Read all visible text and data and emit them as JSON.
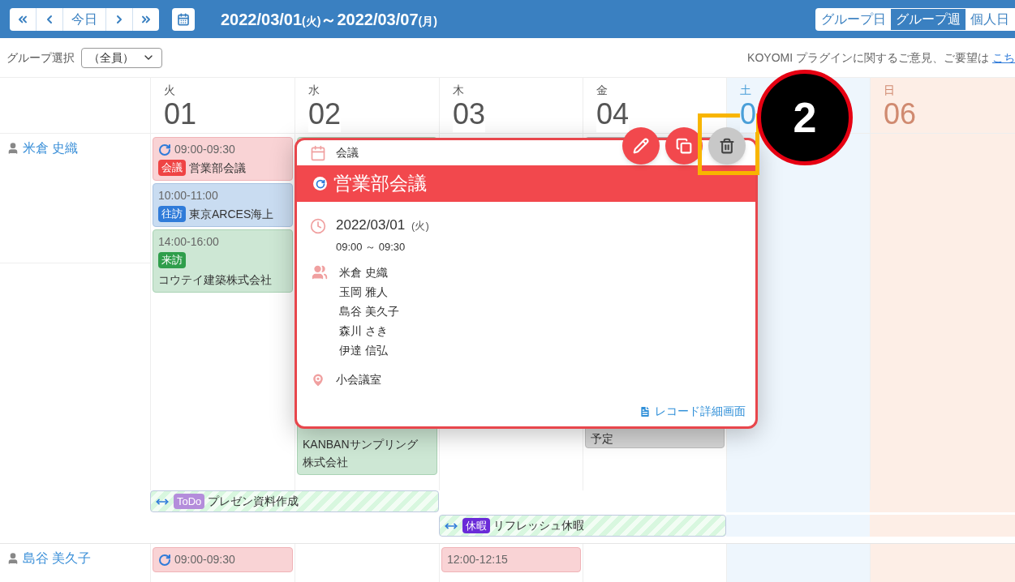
{
  "toolbar": {
    "today_label": "今日",
    "date_range": {
      "start": "2022/03/01",
      "start_weekday": "(火)",
      "separator": "～",
      "end": "2022/03/07",
      "end_weekday": "(月)"
    },
    "view_tabs": [
      {
        "label": "グループ日",
        "selected": false
      },
      {
        "label": "グループ週",
        "selected": true
      },
      {
        "label": "個人日",
        "selected": false
      }
    ]
  },
  "group_select": {
    "label": "グループ選択",
    "value": "（全員）"
  },
  "feedback": {
    "text": "KOYOMI プラグインに関するご意見、ご要望は",
    "link": "こち"
  },
  "days": [
    {
      "weekday": "火",
      "date": "01",
      "kind": "weekday"
    },
    {
      "weekday": "水",
      "date": "02",
      "kind": "weekday"
    },
    {
      "weekday": "木",
      "date": "03",
      "kind": "weekday"
    },
    {
      "weekday": "金",
      "date": "04",
      "kind": "weekday"
    },
    {
      "weekday": "土",
      "date": "0",
      "kind": "saturday"
    },
    {
      "weekday": "日",
      "date": "06",
      "kind": "sunday"
    }
  ],
  "members": [
    {
      "name": "米倉 史織",
      "cells": [
        {
          "events": [
            {
              "kind": "meeting",
              "repeat": true,
              "time": "09:00-09:30",
              "category": "会議",
              "title": "営業部会議"
            },
            {
              "kind": "visit_out",
              "repeat": false,
              "time": "10:00-11:00",
              "category": "往訪",
              "title": "東京ARCES海上"
            },
            {
              "kind": "visit_in",
              "repeat": false,
              "time": "14:00-16:00",
              "category": "来訪",
              "title": "コウテイ建築株式会社"
            }
          ]
        },
        {
          "events": [
            {
              "kind": "covered_visit_in",
              "repeat": false,
              "title": "KANBANサンプリング株式会社"
            }
          ]
        },
        {},
        {
          "events": [
            {
              "kind": "covered_other",
              "repeat": false,
              "title": "予定"
            }
          ]
        },
        {},
        {}
      ],
      "all_day": [
        {
          "slots": [
            {
              "kind": "todo",
              "category": "ToDo",
              "title": "プレゼン資料作成"
            },
            {
              "kind": "continued"
            },
            {
              "kind": "empty"
            },
            {
              "kind": "empty"
            },
            {
              "kind": "empty"
            },
            {
              "kind": "empty"
            }
          ]
        },
        {
          "slots": [
            {
              "kind": "empty"
            },
            {
              "kind": "empty"
            },
            {
              "kind": "vacation",
              "category": "休暇",
              "title": "リフレッシュ休暇"
            },
            {
              "kind": "continued"
            },
            {
              "kind": "empty"
            },
            {
              "kind": "empty"
            }
          ]
        }
      ]
    },
    {
      "name": "島谷 美久子",
      "cells": [
        {
          "events": [
            {
              "kind": "meeting",
              "repeat": true,
              "time": "09:00-09:30"
            }
          ]
        },
        {},
        {
          "events": [
            {
              "kind": "meeting",
              "repeat": false,
              "time": "12:00-12:15"
            }
          ]
        },
        {},
        {},
        {}
      ]
    }
  ],
  "popup": {
    "category": "会議",
    "repeat": true,
    "title": "営業部会議",
    "date": "2022/03/01",
    "weekday": "(火)",
    "time": "09:00 ～ 09:30",
    "attendees": [
      "米倉 史織",
      "玉岡 雅人",
      "島谷 美久子",
      "森川 さき",
      "伊達 信弘"
    ],
    "location": "小会議室",
    "detail_link": "レコード詳細画面",
    "actions": [
      {
        "kind": "edit",
        "highlighted": false
      },
      {
        "kind": "copy",
        "highlighted": false
      },
      {
        "kind": "delete",
        "highlighted": true
      }
    ]
  },
  "callout": {
    "number": "2"
  }
}
